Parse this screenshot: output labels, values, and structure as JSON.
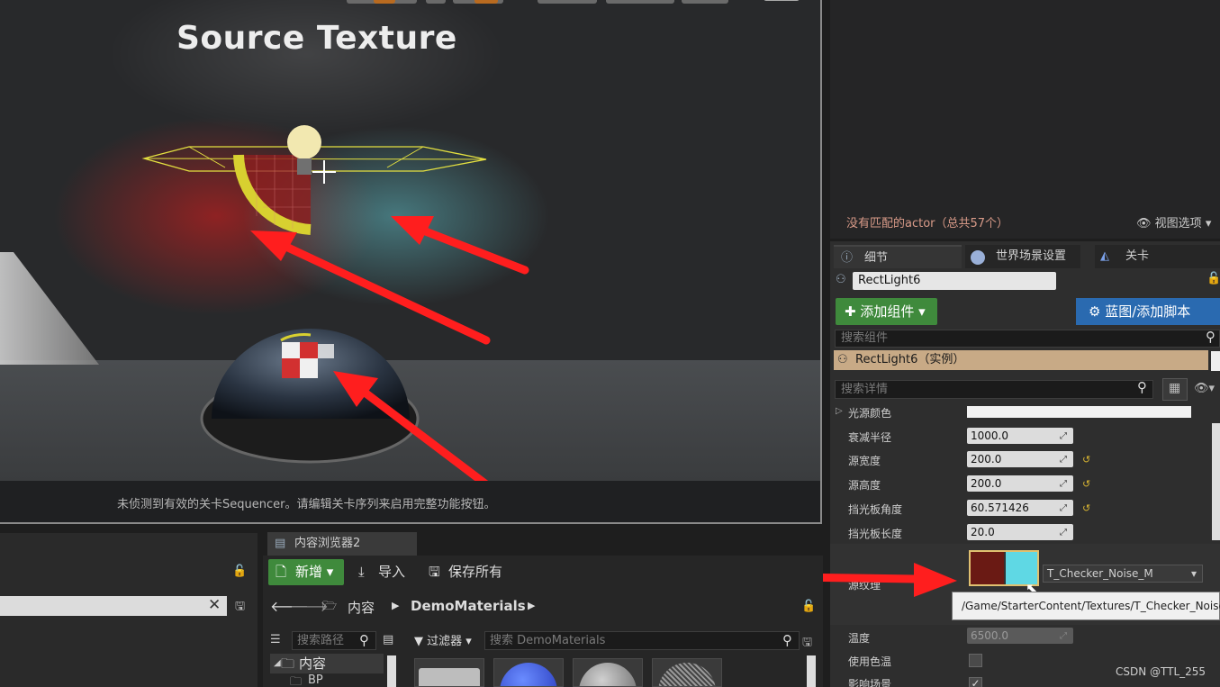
{
  "viewport": {
    "title": "Source Texture",
    "status_message": "未侦测到有效的关卡Sequencer。请编辑关卡序列来启用完整功能按钮。"
  },
  "outliner": {
    "no_match": "没有匹配的actor（总共57个）",
    "view_options": "视图选项"
  },
  "details": {
    "tabs": [
      {
        "label": "细节",
        "icon": "info-icon"
      },
      {
        "label": "世界场景设置",
        "icon": "globe-icon"
      },
      {
        "label": "关卡",
        "icon": "level-icon"
      }
    ],
    "actor_name": "RectLight6",
    "add_component": "添加组件",
    "blueprint_script": "蓝图/添加脚本",
    "search_components_placeholder": "搜索组件",
    "instance_label": "RectLight6（实例）",
    "search_details_placeholder": "搜索详情",
    "properties": {
      "light_color": {
        "label": "光源颜色",
        "color": "#f2f2f2"
      },
      "attenuation_radius": {
        "label": "衰减半径",
        "value": "1000.0"
      },
      "source_width": {
        "label": "源宽度",
        "value": "200.0"
      },
      "source_height": {
        "label": "源高度",
        "value": "200.0"
      },
      "barn_door_angle": {
        "label": "挡光板角度",
        "value": "60.571426"
      },
      "barn_door_length": {
        "label": "挡光板长度",
        "value": "20.0"
      },
      "source_texture": {
        "label": "源纹理",
        "value": "T_Checker_Noise_M"
      },
      "temperature": {
        "label": "温度",
        "value": "6500.0"
      },
      "use_temperature": {
        "label": "使用色温",
        "checked": false
      },
      "affects_world": {
        "label": "影响场景",
        "checked": true
      }
    },
    "tooltip_path": "/Game/StarterContent/Textures/T_Checker_Noise_M"
  },
  "content_browser": {
    "tab_label": "内容浏览器2",
    "new_button": "新增",
    "import_button": "导入",
    "save_all_button": "保存所有",
    "breadcrumb": [
      "内容",
      "DemoMaterials"
    ],
    "search_path_placeholder": "搜索路径",
    "filter_label": "过滤器",
    "search_placeholder": "搜索 DemoMaterials",
    "tree": [
      "内容",
      "BP"
    ]
  },
  "watermark": "CSDN @TTL_255",
  "colors": {
    "arrow": "#ff1e1e",
    "add_green": "#3f8a3c",
    "blueprint_blue": "#2a6ab0",
    "instance_tan": "#c8aa86",
    "reset_yellow": "#d8b432"
  }
}
